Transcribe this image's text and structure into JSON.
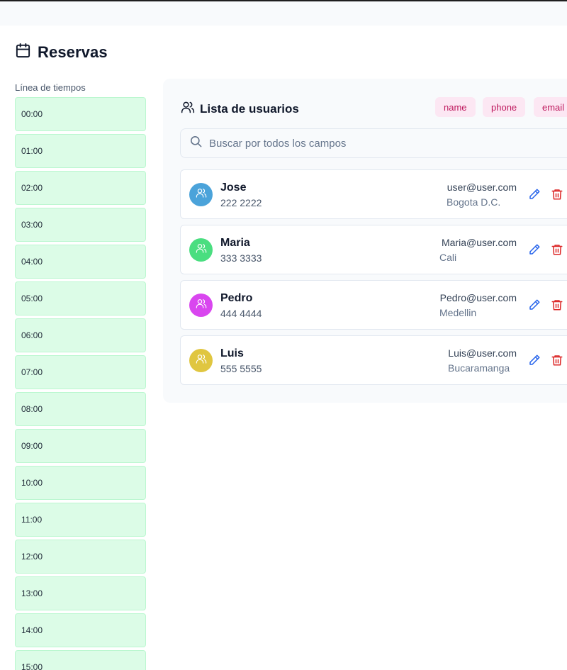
{
  "page": {
    "title": "Reservas",
    "timeline_label": "Línea de tiempos"
  },
  "timeline": [
    "00:00",
    "01:00",
    "02:00",
    "03:00",
    "04:00",
    "05:00",
    "06:00",
    "07:00",
    "08:00",
    "09:00",
    "10:00",
    "11:00",
    "12:00",
    "13:00",
    "14:00",
    "15:00"
  ],
  "users_panel": {
    "title": "Lista de usuarios",
    "filters": [
      "name",
      "phone",
      "email"
    ],
    "search_placeholder": "Buscar por todos los campos",
    "users": [
      {
        "name": "Jose",
        "phone": "222 2222",
        "email": "user@user.com",
        "city": "Bogota D.C.",
        "avatar_color": "#4ba3da"
      },
      {
        "name": "Maria",
        "phone": "333 3333",
        "email": "Maria@user.com",
        "city": "Cali",
        "avatar_color": "#4ade80"
      },
      {
        "name": "Pedro",
        "phone": "444 4444",
        "email": "Pedro@user.com",
        "city": "Medellin",
        "avatar_color": "#d946ef"
      },
      {
        "name": "Luis",
        "phone": "555 5555",
        "email": "Luis@user.com",
        "city": "Bucaramanga",
        "avatar_color": "#e0c640"
      }
    ]
  },
  "icons": {
    "title": "calendar-icon",
    "panel": "users-icon",
    "search": "search-icon",
    "avatar": "users-icon",
    "edit": "pencil-icon",
    "delete": "trash-icon"
  },
  "colors": {
    "slot_bg": "#dcfce7",
    "chip_bg": "#fce7f3",
    "chip_text": "#be185d",
    "edit": "#2563eb",
    "delete": "#dc2626"
  }
}
